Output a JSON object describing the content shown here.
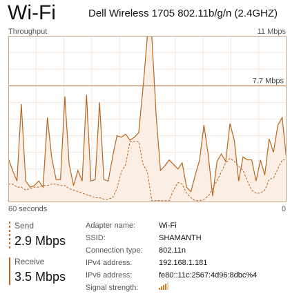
{
  "header": {
    "title": "Wi-Fi",
    "adapter": "Dell Wireless 1705 802.11b/g/n (2.4GHZ)"
  },
  "graph": {
    "label": "Throughput",
    "max_label": "11 Mbps",
    "ref_label": "7.7 Mbps",
    "time_label": "60 seconds",
    "zero_label": "0",
    "line_color": "#b5651d",
    "fill_color": "#fbeee4"
  },
  "chart_data": {
    "type": "area",
    "x_unit": "seconds ago",
    "ylim": [
      0,
      11
    ],
    "reference_line": 7.7,
    "series": [
      {
        "name": "Receive",
        "style": "solid",
        "values": [
          2.9,
          2.1,
          1.4,
          6.5,
          1.4,
          1.0,
          1.1,
          1.4,
          1.0,
          5.6,
          2.9,
          1.5,
          1.5,
          7.0,
          2.5,
          1.1,
          2.1,
          1.4,
          7.1,
          1.4,
          1.5,
          6.6,
          1.5,
          1.4,
          3.0,
          4.4,
          4.3,
          4.5,
          4.1,
          4.3,
          4.6,
          7.6,
          11.5,
          11.5,
          5.8,
          2.1,
          2.4,
          2.8,
          2.5,
          2.2,
          2.6,
          1.0,
          0.7,
          1.8,
          2.8,
          5.1,
          3.1,
          0.4,
          2.7,
          3.2,
          2.7,
          5.2,
          4.1,
          1.4,
          3.0,
          2.8,
          2.8,
          1.4,
          2.8,
          1.8,
          4.2,
          3.3,
          5.1,
          5.6,
          2.8
        ]
      },
      {
        "name": "Send",
        "style": "dashed",
        "values": [
          1.2,
          1.2,
          1.0,
          1.0,
          0.8,
          0.9,
          1.0,
          1.0,
          1.1,
          1.1,
          1.2,
          1.2,
          1.1,
          1.1,
          0.9,
          0.8,
          0.7,
          0.6,
          0.5,
          0.4,
          0.3,
          0.3,
          0.2,
          0.2,
          0.3,
          0.9,
          2.0,
          2.5,
          4.0,
          4.0,
          4.0,
          2.5,
          2.0,
          0.1,
          0.1,
          0.1,
          0.1,
          0.1,
          0.8,
          1.3,
          1.2,
          0.6,
          0.3,
          0.1,
          0.1,
          0.2,
          0.4,
          0.9,
          1.4,
          2.0,
          2.6,
          2.9,
          2.7,
          2.4,
          2.1,
          1.4,
          0.8,
          0.6,
          0.6,
          0.8,
          1.5,
          1.6,
          2.2,
          2.8,
          2.8
        ]
      }
    ]
  },
  "stats": {
    "send_label": "Send",
    "send_value": "2.9 Mbps",
    "receive_label": "Receive",
    "receive_value": "3.5 Mbps"
  },
  "details": {
    "adapter_name_label": "Adapter name:",
    "adapter_name": "Wi-Fi",
    "ssid_label": "SSID:",
    "ssid": "SHAMANTH",
    "connection_type_label": "Connection type:",
    "connection_type": "802.11n",
    "ipv4_label": "IPv4 address:",
    "ipv4": "192.168.1.181",
    "ipv6_label": "IPv6 address:",
    "ipv6": "fe80::11c:2567:4d96:8dbc%4",
    "signal_label": "Signal strength:",
    "signal_bars": 4,
    "signal_max": 5
  }
}
